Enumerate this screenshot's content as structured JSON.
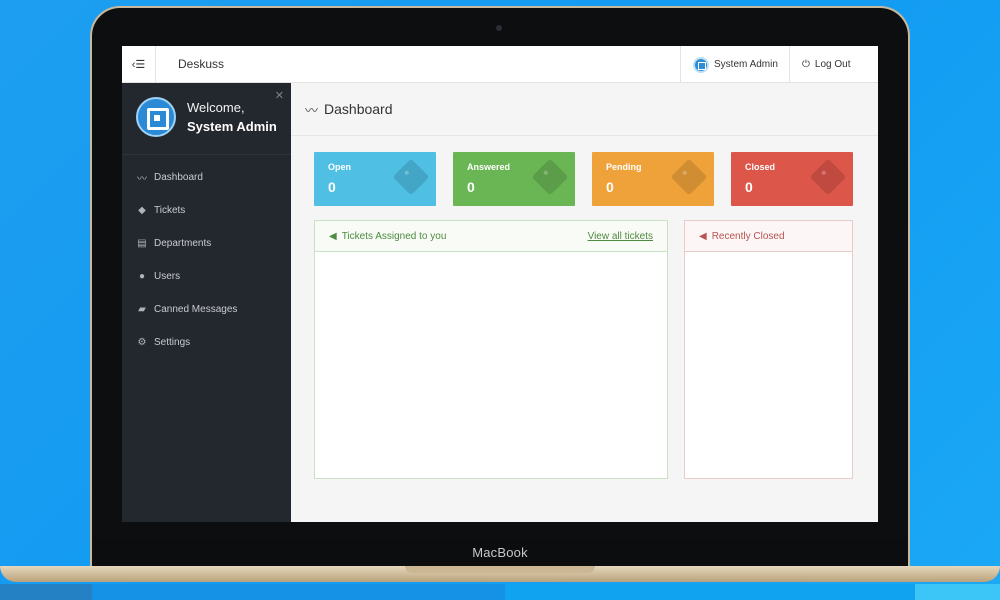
{
  "device": {
    "label": "MacBook"
  },
  "app": {
    "brand": "Deskuss",
    "toggle_icon": "‹☰",
    "user_name": "System Admin",
    "logout_label": "Log Out"
  },
  "sidebar": {
    "welcome_label": "Welcome,",
    "welcome_name": "System Admin",
    "items": [
      {
        "label": "Dashboard",
        "icon": "pulse-icon"
      },
      {
        "label": "Tickets",
        "icon": "tag-icon"
      },
      {
        "label": "Departments",
        "icon": "id-card-icon"
      },
      {
        "label": "Users",
        "icon": "users-icon"
      },
      {
        "label": "Canned Messages",
        "icon": "comments-icon"
      },
      {
        "label": "Settings",
        "icon": "gears-icon"
      }
    ]
  },
  "page": {
    "title": "Dashboard"
  },
  "stats": [
    {
      "label": "Open",
      "value": "0",
      "color": "#4fbfe4"
    },
    {
      "label": "Answered",
      "value": "0",
      "color": "#6ab554"
    },
    {
      "label": "Pending",
      "value": "0",
      "color": "#f0a23a"
    },
    {
      "label": "Closed",
      "value": "0",
      "color": "#dd564a"
    }
  ],
  "panels": {
    "assigned": {
      "title": "Tickets Assigned to you",
      "link": "View all tickets"
    },
    "closed": {
      "title": "Recently Closed"
    }
  }
}
